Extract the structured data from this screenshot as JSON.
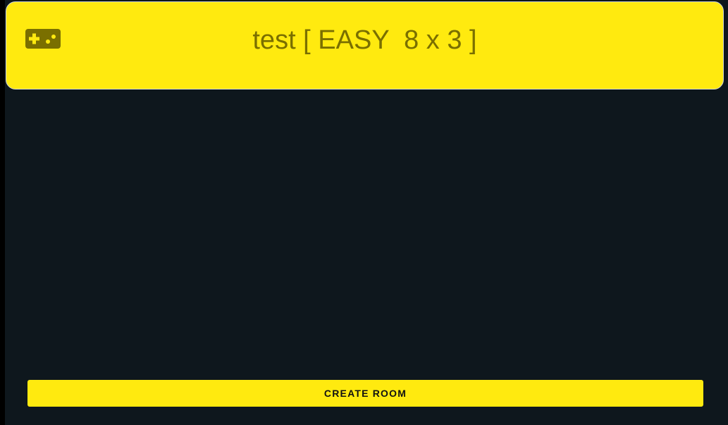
{
  "header": {
    "title": "test [ EASY  8 x 3 ]",
    "icon": "gamepad-icon"
  },
  "actions": {
    "create_room_label": "CREATE ROOM"
  },
  "colors": {
    "accent": "#ffea0f",
    "background": "#0e171d",
    "title_text": "#7a6f00"
  }
}
